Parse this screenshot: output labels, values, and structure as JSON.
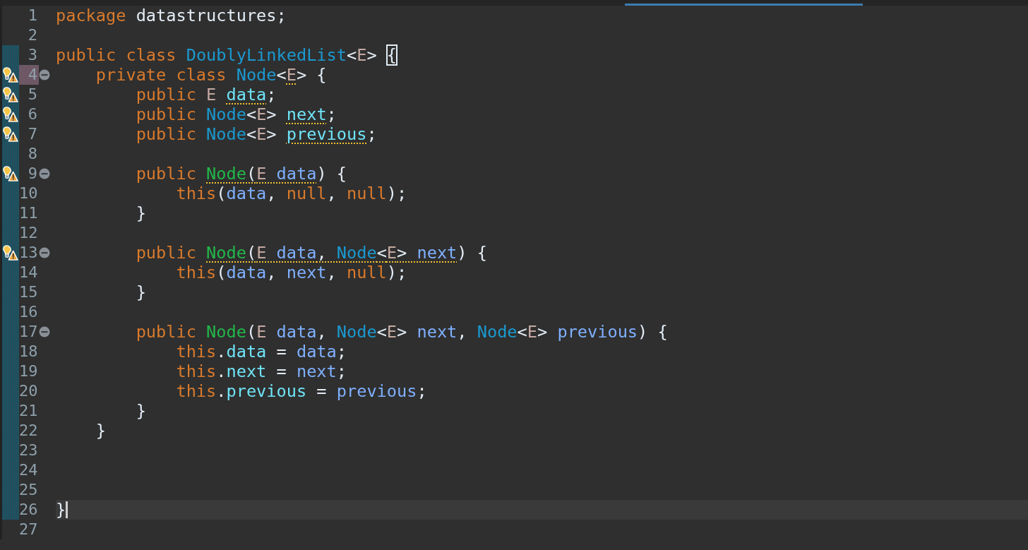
{
  "editor": {
    "lines": [
      {
        "number": "1",
        "changed": false,
        "warning": false,
        "foldable": false,
        "highlighted": false,
        "current": false,
        "tokens": [
          {
            "kind": "keyword",
            "text": "package"
          },
          {
            "kind": "plain",
            "text": " datastructures;"
          }
        ]
      },
      {
        "number": "2",
        "changed": false,
        "warning": false,
        "foldable": false,
        "highlighted": false,
        "current": false
      },
      {
        "number": "3",
        "changed": true,
        "warning": false,
        "foldable": false,
        "highlighted": false,
        "current": false,
        "tokens": [
          {
            "kind": "keyword",
            "text": "public class "
          },
          {
            "kind": "type",
            "text": "DoublyLinkedList"
          },
          {
            "kind": "plain",
            "text": "<"
          },
          {
            "kind": "typeparam",
            "text": "E"
          },
          {
            "kind": "plain",
            "text": "> "
          },
          {
            "kind": "bracket-match",
            "text": "{"
          }
        ]
      },
      {
        "number": "4",
        "changed": true,
        "warning": true,
        "foldable": true,
        "highlighted": true,
        "current": false,
        "tokens": [
          {
            "kind": "keyword",
            "text": "    private class "
          },
          {
            "kind": "type",
            "text": "Node"
          },
          {
            "kind": "plain",
            "text": "<"
          },
          {
            "kind": "typeparam",
            "text": "E",
            "warned": true
          },
          {
            "kind": "plain",
            "text": "> {"
          }
        ]
      },
      {
        "number": "5",
        "changed": true,
        "warning": true,
        "foldable": false,
        "highlighted": false,
        "current": false,
        "tokens": [
          {
            "kind": "keyword",
            "text": "        public "
          },
          {
            "kind": "typeparam",
            "text": "E "
          },
          {
            "kind": "field",
            "text": "data",
            "warned": true
          },
          {
            "kind": "plain",
            "text": ";"
          }
        ]
      },
      {
        "number": "6",
        "changed": true,
        "warning": true,
        "foldable": false,
        "highlighted": false,
        "current": false,
        "tokens": [
          {
            "kind": "keyword",
            "text": "        public "
          },
          {
            "kind": "type",
            "text": "Node"
          },
          {
            "kind": "plain",
            "text": "<"
          },
          {
            "kind": "typeparam",
            "text": "E"
          },
          {
            "kind": "plain",
            "text": "> "
          },
          {
            "kind": "field",
            "text": "next",
            "warned": true
          },
          {
            "kind": "plain",
            "text": ";"
          }
        ]
      },
      {
        "number": "7",
        "changed": true,
        "warning": true,
        "foldable": false,
        "highlighted": false,
        "current": false,
        "tokens": [
          {
            "kind": "keyword",
            "text": "        public "
          },
          {
            "kind": "type",
            "text": "Node"
          },
          {
            "kind": "plain",
            "text": "<"
          },
          {
            "kind": "typeparam",
            "text": "E"
          },
          {
            "kind": "plain",
            "text": "> "
          },
          {
            "kind": "field",
            "text": "previous",
            "warned": true
          },
          {
            "kind": "plain",
            "text": ";"
          }
        ]
      },
      {
        "number": "8",
        "changed": true,
        "warning": false,
        "foldable": false,
        "highlighted": false,
        "current": false
      },
      {
        "number": "9",
        "changed": true,
        "warning": true,
        "foldable": true,
        "highlighted": false,
        "current": false,
        "tokens": [
          {
            "kind": "keyword",
            "text": "        public "
          },
          {
            "kind": "method",
            "text": "Node",
            "warned": true
          },
          {
            "kind": "plain",
            "text": "(",
            "warned": true
          },
          {
            "kind": "typeparam",
            "text": "E ",
            "warned": true
          },
          {
            "kind": "param",
            "text": "data",
            "warned": true
          },
          {
            "kind": "plain",
            "text": ") {"
          }
        ]
      },
      {
        "number": "10",
        "changed": true,
        "warning": false,
        "foldable": false,
        "highlighted": false,
        "current": false,
        "tokens": [
          {
            "kind": "keyword",
            "text": "            this"
          },
          {
            "kind": "plain",
            "text": "("
          },
          {
            "kind": "param",
            "text": "data"
          },
          {
            "kind": "plain",
            "text": ", "
          },
          {
            "kind": "keyword",
            "text": "null"
          },
          {
            "kind": "plain",
            "text": ", "
          },
          {
            "kind": "keyword",
            "text": "null"
          },
          {
            "kind": "plain",
            "text": ");"
          }
        ]
      },
      {
        "number": "11",
        "changed": true,
        "warning": false,
        "foldable": false,
        "highlighted": false,
        "current": false,
        "tokens": [
          {
            "kind": "plain",
            "text": "        }"
          }
        ]
      },
      {
        "number": "12",
        "changed": true,
        "warning": false,
        "foldable": false,
        "highlighted": false,
        "current": false
      },
      {
        "number": "13",
        "changed": true,
        "warning": true,
        "foldable": true,
        "highlighted": false,
        "current": false,
        "tokens": [
          {
            "kind": "keyword",
            "text": "        public "
          },
          {
            "kind": "method",
            "text": "Node",
            "warned": true
          },
          {
            "kind": "plain",
            "text": "(",
            "warned": true
          },
          {
            "kind": "typeparam",
            "text": "E ",
            "warned": true
          },
          {
            "kind": "param",
            "text": "data",
            "warned": true
          },
          {
            "kind": "plain",
            "text": ", ",
            "warned": true
          },
          {
            "kind": "type",
            "text": "Node",
            "warned": true
          },
          {
            "kind": "plain",
            "text": "<",
            "warned": true
          },
          {
            "kind": "typeparam",
            "text": "E",
            "warned": true
          },
          {
            "kind": "plain",
            "text": "> ",
            "warned": true
          },
          {
            "kind": "param",
            "text": "next",
            "warned": true
          },
          {
            "kind": "plain",
            "text": ") {"
          }
        ]
      },
      {
        "number": "14",
        "changed": true,
        "warning": false,
        "foldable": false,
        "highlighted": false,
        "current": false,
        "tokens": [
          {
            "kind": "keyword",
            "text": "            this"
          },
          {
            "kind": "plain",
            "text": "("
          },
          {
            "kind": "param",
            "text": "data"
          },
          {
            "kind": "plain",
            "text": ", "
          },
          {
            "kind": "param",
            "text": "next"
          },
          {
            "kind": "plain",
            "text": ", "
          },
          {
            "kind": "keyword",
            "text": "null"
          },
          {
            "kind": "plain",
            "text": ");"
          }
        ]
      },
      {
        "number": "15",
        "changed": true,
        "warning": false,
        "foldable": false,
        "highlighted": false,
        "current": false,
        "tokens": [
          {
            "kind": "plain",
            "text": "        }"
          }
        ]
      },
      {
        "number": "16",
        "changed": true,
        "warning": false,
        "foldable": false,
        "highlighted": false,
        "current": false
      },
      {
        "number": "17",
        "changed": true,
        "warning": false,
        "foldable": true,
        "highlighted": false,
        "current": false,
        "tokens": [
          {
            "kind": "keyword",
            "text": "        public "
          },
          {
            "kind": "method",
            "text": "Node"
          },
          {
            "kind": "plain",
            "text": "("
          },
          {
            "kind": "typeparam",
            "text": "E "
          },
          {
            "kind": "param",
            "text": "data"
          },
          {
            "kind": "plain",
            "text": ", "
          },
          {
            "kind": "type",
            "text": "Node"
          },
          {
            "kind": "plain",
            "text": "<"
          },
          {
            "kind": "typeparam",
            "text": "E"
          },
          {
            "kind": "plain",
            "text": "> "
          },
          {
            "kind": "param",
            "text": "next"
          },
          {
            "kind": "plain",
            "text": ", "
          },
          {
            "kind": "type",
            "text": "Node"
          },
          {
            "kind": "plain",
            "text": "<"
          },
          {
            "kind": "typeparam",
            "text": "E"
          },
          {
            "kind": "plain",
            "text": "> "
          },
          {
            "kind": "param",
            "text": "previous"
          },
          {
            "kind": "plain",
            "text": ") {"
          }
        ]
      },
      {
        "number": "18",
        "changed": true,
        "warning": false,
        "foldable": false,
        "highlighted": false,
        "current": false,
        "tokens": [
          {
            "kind": "keyword",
            "text": "            this"
          },
          {
            "kind": "plain",
            "text": "."
          },
          {
            "kind": "field",
            "text": "data"
          },
          {
            "kind": "plain",
            "text": " = "
          },
          {
            "kind": "param",
            "text": "data"
          },
          {
            "kind": "plain",
            "text": ";"
          }
        ]
      },
      {
        "number": "19",
        "changed": true,
        "warning": false,
        "foldable": false,
        "highlighted": false,
        "current": false,
        "tokens": [
          {
            "kind": "keyword",
            "text": "            this"
          },
          {
            "kind": "plain",
            "text": "."
          },
          {
            "kind": "field",
            "text": "next"
          },
          {
            "kind": "plain",
            "text": " = "
          },
          {
            "kind": "param",
            "text": "next"
          },
          {
            "kind": "plain",
            "text": ";"
          }
        ]
      },
      {
        "number": "20",
        "changed": true,
        "warning": false,
        "foldable": false,
        "highlighted": false,
        "current": false,
        "tokens": [
          {
            "kind": "keyword",
            "text": "            this"
          },
          {
            "kind": "plain",
            "text": "."
          },
          {
            "kind": "field",
            "text": "previous"
          },
          {
            "kind": "plain",
            "text": " = "
          },
          {
            "kind": "param",
            "text": "previous"
          },
          {
            "kind": "plain",
            "text": ";"
          }
        ]
      },
      {
        "number": "21",
        "changed": true,
        "warning": false,
        "foldable": false,
        "highlighted": false,
        "current": false,
        "tokens": [
          {
            "kind": "plain",
            "text": "        }"
          }
        ]
      },
      {
        "number": "22",
        "changed": true,
        "warning": false,
        "foldable": false,
        "highlighted": false,
        "current": false,
        "tokens": [
          {
            "kind": "plain",
            "text": "    }"
          }
        ]
      },
      {
        "number": "23",
        "changed": true,
        "warning": false,
        "foldable": false,
        "highlighted": false,
        "current": false
      },
      {
        "number": "24",
        "changed": true,
        "warning": false,
        "foldable": false,
        "highlighted": false,
        "current": false
      },
      {
        "number": "25",
        "changed": true,
        "warning": false,
        "foldable": false,
        "highlighted": false,
        "current": false
      },
      {
        "number": "26",
        "changed": true,
        "warning": false,
        "foldable": false,
        "highlighted": false,
        "current": true,
        "tokens": [
          {
            "kind": "plain",
            "text": "}"
          }
        ]
      },
      {
        "number": "27",
        "changed": false,
        "warning": false,
        "foldable": false,
        "highlighted": false,
        "current": false
      }
    ]
  }
}
